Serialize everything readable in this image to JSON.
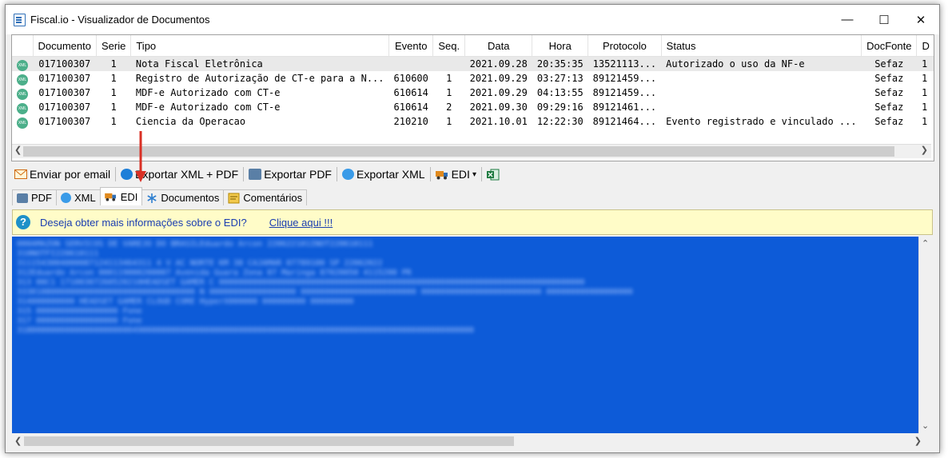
{
  "window": {
    "title": "Fiscal.io - Visualizador de Documentos",
    "controls": [
      "—",
      "☐",
      "✕"
    ]
  },
  "grid": {
    "columns": [
      "Documento",
      "Serie",
      "Tipo",
      "Evento",
      "Seq.",
      "Data",
      "Hora",
      "Protocolo",
      "Status",
      "DocFonte",
      "D"
    ],
    "rows": [
      [
        "017100307",
        "1",
        "Nota Fiscal Eletrônica",
        "",
        "",
        "2021.09.28",
        "20:35:35",
        "13521113...",
        "Autorizado o uso da NF-e",
        "Sefaz",
        "1"
      ],
      [
        "017100307",
        "1",
        "Registro de Autorização de CT-e para a N...",
        "610600",
        "1",
        "2021.09.29",
        "03:27:13",
        "89121459...",
        "",
        "Sefaz",
        "1"
      ],
      [
        "017100307",
        "1",
        "MDF-e Autorizado com CT-e",
        "610614",
        "1",
        "2021.09.29",
        "04:13:55",
        "89121459...",
        "",
        "Sefaz",
        "1"
      ],
      [
        "017100307",
        "1",
        "MDF-e Autorizado com CT-e",
        "610614",
        "2",
        "2021.09.30",
        "09:29:16",
        "89121461...",
        "",
        "Sefaz",
        "1"
      ],
      [
        "017100307",
        "1",
        "Ciencia da Operacao",
        "210210",
        "1",
        "2021.10.01",
        "12:22:30",
        "89121464...",
        "Evento registrado e vinculado ...",
        "Sefaz",
        "1"
      ]
    ],
    "row_icon": "xml-doc-icon",
    "row_icon_text": "XML"
  },
  "toolbar": {
    "email": "Enviar por email",
    "export_xml_pdf": "Exportar XML + PDF",
    "export_pdf": "Exportar PDF",
    "export_xml": "Exportar XML",
    "edi": "EDI",
    "edi_caret": "▾"
  },
  "tabs": {
    "pdf": "PDF",
    "xml": "XML",
    "edi": "EDI",
    "documentos": "Documentos",
    "comentarios": "Comentários"
  },
  "infobar": {
    "icon": "?",
    "text": "Deseja obter mais informações sobre o EDI?",
    "link": "Clique aqui !!!"
  },
  "edi_lines": [
    "000AMAZON SERVICOS DE VAREJO DO BRASILEduardo Arcon                 220622101INOT220610111",
    "310NOTFI220610111",
    "3111543004000087124113464311 4  V AC NORTE KM 38               CAJAMAR                 07789100 SP      22062022",
    "312Eduardo Arcon                000119000200007          Avenida Guara                   Zona 07        Maringa                       87020050 4115200  PR",
    "313         00C1 17100307260520210HEADSET GAMER C         0000000000000000000000000000000000000000000000000000000000000000000000000000",
    "3330108000000000000000000000000000000          N        000000000000000000   000000000000000000000000   0000000000000000000000000   000000000000000000",
    "314000000000          HEADSET GAMER CLOUD CORE HyperX000000                    000000000                                        000000000",
    "315                       00000000000000000                                                                                    Fone",
    "317                       00000000000000000                                                                                    Fone",
    "31800000000000000000000049000000000000000000000000000000000000000000000000000000000000000000000"
  ],
  "colors": {
    "accent": "#0d5bd8",
    "selected_row": "#e9e9e9",
    "infobar": "#fffcc8",
    "arrow": "#d93025"
  }
}
